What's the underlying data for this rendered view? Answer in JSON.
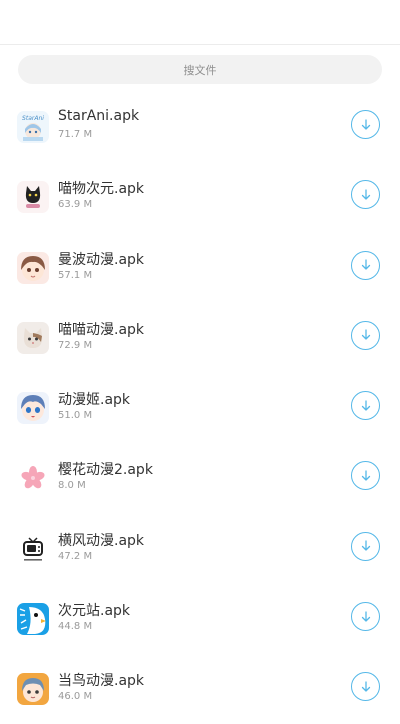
{
  "search": {
    "placeholder": "搜文件"
  },
  "files": [
    {
      "name": "StarAni.apk",
      "size": "71.7 M",
      "icon": "starani-app-icon"
    },
    {
      "name": "喵物次元.apk",
      "size": "63.9 M",
      "icon": "black-cat-app-icon"
    },
    {
      "name": "曼波动漫.apk",
      "size": "57.1 M",
      "icon": "anime-girl-brown-hair-app-icon"
    },
    {
      "name": "喵喵动漫.apk",
      "size": "72.9 M",
      "icon": "kitten-app-icon"
    },
    {
      "name": "动漫姬.apk",
      "size": "51.0 M",
      "icon": "anime-girl-blue-hair-app-icon"
    },
    {
      "name": "樱花动漫2.apk",
      "size": "8.0 M",
      "icon": "sakura-flower-app-icon"
    },
    {
      "name": "横风动漫.apk",
      "size": "47.2 M",
      "icon": "retro-tv-app-icon"
    },
    {
      "name": "次元站.apk",
      "size": "44.8 M",
      "icon": "penguin-app-icon"
    },
    {
      "name": "当鸟动漫.apk",
      "size": "46.0 M",
      "icon": "anime-kid-app-icon"
    }
  ],
  "colors": {
    "download_accent": "#55b8e8",
    "sakura": "#f6a6b8",
    "penguin_bg": "#1aa0e6"
  }
}
